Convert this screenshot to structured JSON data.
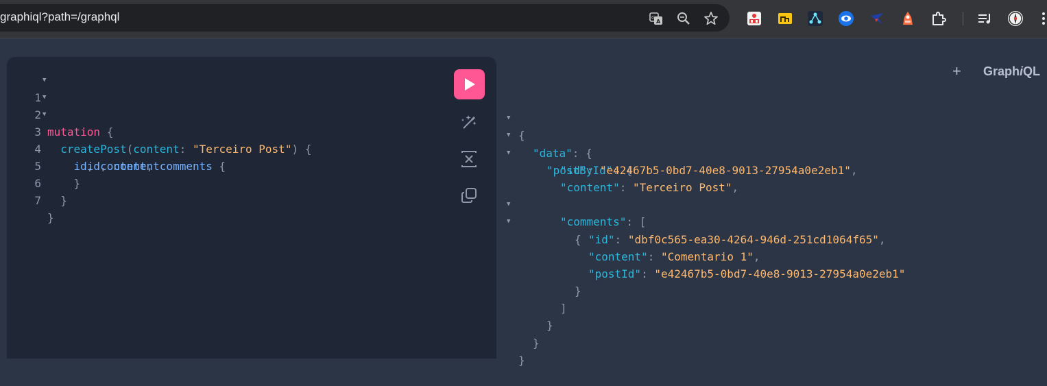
{
  "browser": {
    "url": "graphiql?path=/graphql",
    "omnibox_icons": [
      "translate-icon",
      "zoom-icon",
      "bookmark-star-icon"
    ],
    "extensions": [
      "extension-red-grid-icon",
      "extension-folder-icon",
      "extension-network-icon",
      "extension-eye-icon",
      "extension-bird-icon",
      "extension-orange-icon",
      "extensions-puzzle-icon",
      "media-queue-icon",
      "profile-avatar-icon",
      "menu-dots-icon"
    ]
  },
  "graphiql": {
    "brand_prefix": "Graph",
    "brand_italic": "i",
    "brand_suffix": "QL",
    "add_tab_label": "+",
    "run_button_color": "#ff5794"
  },
  "editor": {
    "line_numbers": [
      "1",
      "2",
      "3",
      "4",
      "5",
      "6",
      "7"
    ],
    "line1": {
      "keyword": "mutation",
      "brace": "{"
    },
    "line2": {
      "field": "createPost",
      "paren_open": "(",
      "arg": "content",
      "colon": ":",
      "value": "\"Terceiro Post\"",
      "paren_close": ")",
      "brace": "{"
    },
    "line3": {
      "id": "id",
      "comma1": ",",
      "content": "content",
      "comma2": ",",
      "comments": "comments",
      "brace": "{"
    },
    "line4": {
      "id": "id",
      "comma": ",",
      "content": "content"
    },
    "line5": {
      "brace": "}"
    },
    "line6": {
      "brace": "}"
    },
    "line7": {
      "brace": "}"
    }
  },
  "result": {
    "open_brace": "{",
    "data_key": "\"data\"",
    "post_key": "\"postById\"",
    "id_key": "\"id\"",
    "id_value": "\"e42467b5-0bd7-40e8-9013-27954a0e2eb1\"",
    "content_key": "\"content\"",
    "content_value": "\"Terceiro Post\"",
    "comments_key": "\"comments\"",
    "comment_id_key": "\"id\"",
    "comment_id_value": "\"dbf0c565-ea30-4264-946d-251cd1064f65\"",
    "comment_content_key": "\"content\"",
    "comment_content_value": "\"Comentario 1\"",
    "comment_post_id_key": "\"postId\"",
    "comment_post_id_value": "\"e42467b5-0bd7-40e8-9013-27954a0e2eb1\"",
    "colon": ":",
    "comma": ",",
    "obj_open": "{",
    "obj_close": "}",
    "arr_open": "[",
    "arr_close": "]"
  }
}
